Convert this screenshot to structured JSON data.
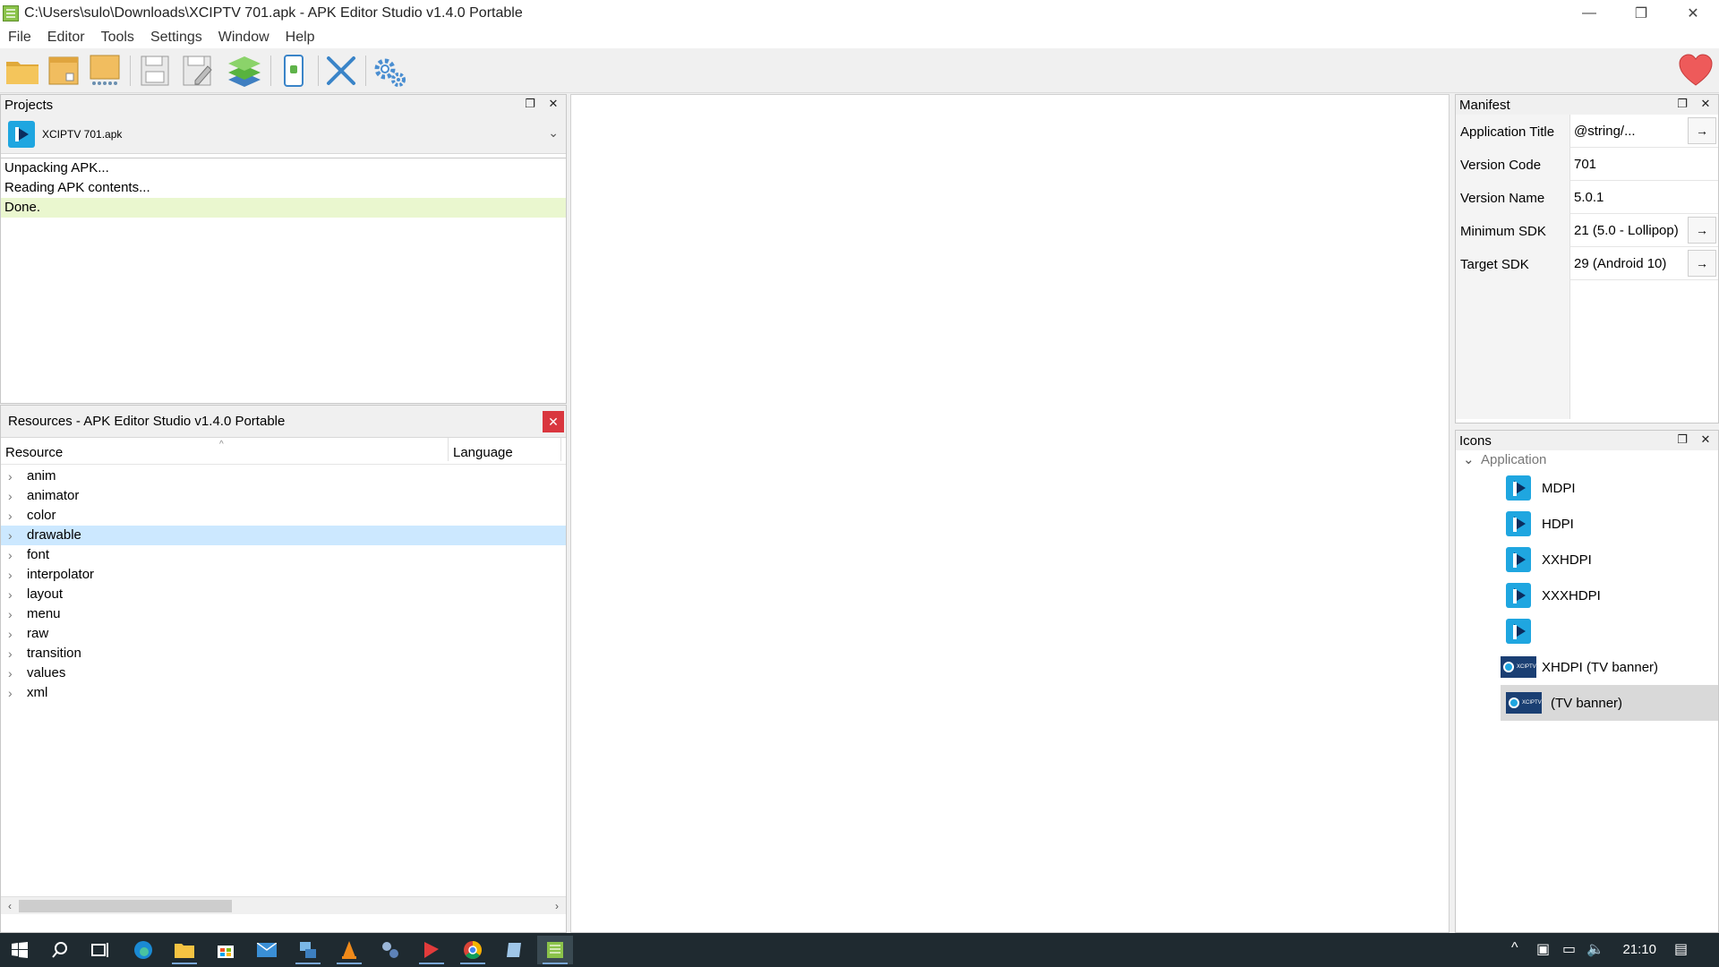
{
  "window": {
    "title": "C:\\Users\\sulo\\Downloads\\XCIPTV 701.apk  - APK Editor Studio v1.4.0 Portable",
    "minimize": "—",
    "restore": "❐",
    "close": "✕"
  },
  "menu": [
    "File",
    "Editor",
    "Tools",
    "Settings",
    "Window",
    "Help"
  ],
  "toolbar": {
    "icons": [
      "open-apk-icon",
      "open-contents-icon",
      "install-apk-icon",
      "save-apk-icon",
      "save-as-icon",
      "optimize-icon",
      "android-device-icon",
      "close-apk-icon",
      "settings-icon",
      "donate-heart-icon"
    ]
  },
  "projects": {
    "title": "Projects",
    "current": "XCIPTV 701.apk",
    "log": [
      "Unpacking APK...",
      "Reading APK contents...",
      "Done."
    ]
  },
  "resources": {
    "title": "Resources - APK Editor Studio v1.4.0 Portable",
    "close": "✕",
    "columns": [
      "Resource",
      "Language"
    ],
    "items": [
      "anim",
      "animator",
      "color",
      "drawable",
      "font",
      "interpolator",
      "layout",
      "menu",
      "raw",
      "transition",
      "values",
      "xml"
    ],
    "selected": "drawable"
  },
  "manifest": {
    "title": "Manifest",
    "arrow": "→",
    "rows": [
      {
        "label": "Application Title",
        "value": "@string/..."
      },
      {
        "label": "Version Code",
        "value": "701"
      },
      {
        "label": "Version Name",
        "value": "5.0.1"
      },
      {
        "label": "Minimum SDK",
        "value": "21 (5.0 - Lollipop)"
      },
      {
        "label": "Target SDK",
        "value": "29 (Android 10)"
      }
    ]
  },
  "icons_panel": {
    "title": "Icons",
    "group": "Application",
    "items": [
      "MDPI",
      "HDPI",
      "XXHDPI",
      "XXXHDPI",
      "",
      "XHDPI (TV banner)",
      "(TV banner)"
    ],
    "banner_text": "XCIPTV"
  },
  "taskbar": {
    "clock": "21:10"
  }
}
